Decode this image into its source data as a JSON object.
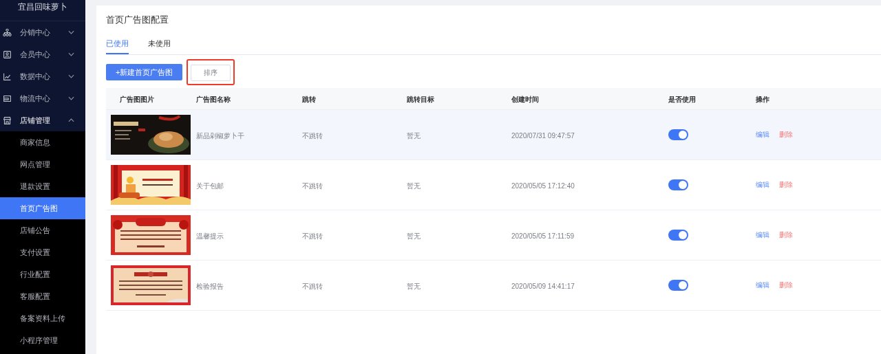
{
  "sidebar": {
    "brand": "宜昌回味萝卜",
    "groups": [
      {
        "label": "分销中心",
        "expanded": false
      },
      {
        "label": "会员中心",
        "expanded": false
      },
      {
        "label": "数据中心",
        "expanded": false
      },
      {
        "label": "物流中心",
        "expanded": false
      },
      {
        "label": "店铺管理",
        "expanded": true,
        "children": [
          {
            "label": "商家信息",
            "selected": false
          },
          {
            "label": "网点管理",
            "selected": false
          },
          {
            "label": "退款设置",
            "selected": false
          },
          {
            "label": "首页广告图",
            "selected": true
          },
          {
            "label": "店铺公告",
            "selected": false
          },
          {
            "label": "支付设置",
            "selected": false
          },
          {
            "label": "行业配置",
            "selected": false
          },
          {
            "label": "客服配置",
            "selected": false
          },
          {
            "label": "备案资料上传",
            "selected": false
          },
          {
            "label": "小程序管理",
            "selected": false
          }
        ]
      }
    ]
  },
  "page": {
    "title": "首页广告图配置",
    "tabs": [
      {
        "label": "已使用",
        "selected": true
      },
      {
        "label": "未使用",
        "selected": false
      }
    ],
    "new_button": "+新建首页广告图",
    "sort_button": {
      "label": "排序",
      "highlighted": true
    }
  },
  "table": {
    "columns": [
      "广告图图片",
      "广告图名称",
      "跳转",
      "跳转目标",
      "创建时间",
      "是否使用",
      "操作"
    ],
    "rows": [
      {
        "name": "新品剁椒萝卜干",
        "jump": "不跳转",
        "target": "暂无",
        "created": "2020/07/31 09:47:57",
        "enabled": true,
        "highlighted": true,
        "actions": [
          {
            "label": "编辑",
            "kind": "edit"
          },
          {
            "label": "删除",
            "kind": "delete"
          }
        ]
      },
      {
        "name": "关于包邮",
        "jump": "不跳转",
        "target": "暂无",
        "created": "2020/05/05 17:12:40",
        "enabled": true,
        "highlighted": false,
        "actions": [
          {
            "label": "编辑",
            "kind": "edit"
          },
          {
            "label": "删除",
            "kind": "delete"
          }
        ]
      },
      {
        "name": "温馨提示",
        "jump": "不跳转",
        "target": "暂无",
        "created": "2020/05/05 17:11:59",
        "enabled": true,
        "highlighted": false,
        "actions": [
          {
            "label": "编辑",
            "kind": "edit"
          },
          {
            "label": "删除",
            "kind": "delete"
          }
        ]
      },
      {
        "name": "检验报告",
        "jump": "不跳转",
        "target": "暂无",
        "created": "2020/05/09 14:41:17",
        "enabled": true,
        "highlighted": false,
        "actions": [
          {
            "label": "编辑",
            "kind": "edit"
          },
          {
            "label": "删除",
            "kind": "delete"
          }
        ]
      }
    ]
  }
}
